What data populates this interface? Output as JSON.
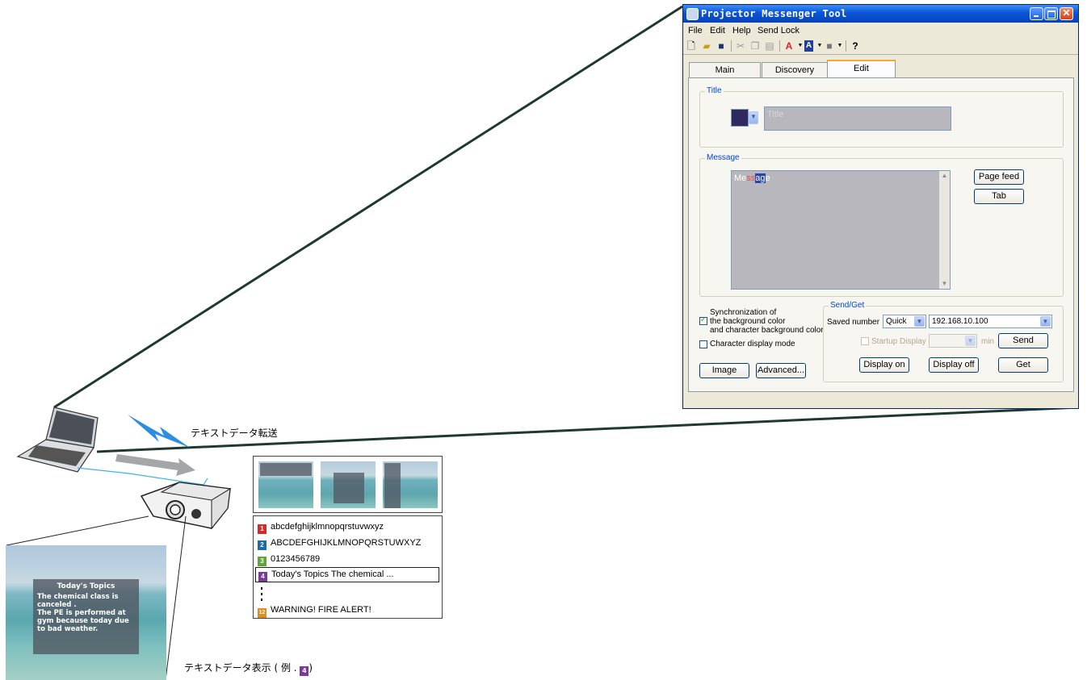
{
  "window": {
    "title": "Projector Messenger Tool",
    "close_glyph": "✕",
    "menu": [
      "File",
      "Edit",
      "Help",
      "Send Lock"
    ],
    "toolbar_icons": [
      "new-file-icon",
      "open-folder-icon",
      "save-icon",
      "cut-icon",
      "copy-icon",
      "paste-icon",
      "font-color-icon",
      "background-color-icon",
      "frame-color-icon",
      "help-icon"
    ],
    "tabs": [
      "Main",
      "Discovery",
      "Edit"
    ],
    "active_tab": "Edit"
  },
  "title_group": {
    "label": "Title",
    "placeholder": "Title",
    "swatch_color": "#2e2a60"
  },
  "message_group": {
    "label": "Message",
    "text_prefix": "Me",
    "text_red": "ss",
    "text_selected": "ag",
    "text_suffix": "e",
    "page_feed_button": "Page feed",
    "tab_button": "Tab"
  },
  "options": {
    "sync_label_line1": "Synchronization of",
    "sync_label_line2": "the background color",
    "sync_label_line3": "and character background color",
    "sync_checked": true,
    "char_mode_label": "Character display mode",
    "char_mode_checked": false,
    "image_button": "Image",
    "advanced_button": "Advanced..."
  },
  "send_get": {
    "label": "Send/Get",
    "saved_number_label": "Saved number",
    "saved_number_value": "Quick",
    "ip_address": "192.168.10.100",
    "startup_display_label": "Startup Display",
    "min_label": "min",
    "send_button": "Send",
    "display_on_button": "Display on",
    "display_off_button": "Display off",
    "get_button": "Get"
  },
  "illustration": {
    "transfer_caption": "テキストデータ転送",
    "display_caption_prefix": "テキストデータ表示 ( 例 . ",
    "display_caption_suffix": ")",
    "topic": {
      "title": "Today's Topics",
      "line1": "The chemical class is",
      "line2": "canceled .",
      "line3": "The PE is performed at",
      "line4": "gym because today due",
      "line5": "to bad weather."
    },
    "list": [
      {
        "num": "1",
        "text": "abcdefghijklmnopqrstuvwxyz",
        "color": "#d32a2a"
      },
      {
        "num": "2",
        "text": "ABCDEFGHIJKLMNOPQRSTUWXYZ",
        "color": "#1d6aa8"
      },
      {
        "num": "3",
        "text": "0123456789",
        "color": "#62a33a"
      },
      {
        "num": "4",
        "text": "Today's Topics The chemical ...",
        "color": "#7b3a9a"
      },
      {
        "num": "12",
        "text": "WARNING! FIRE ALERT!",
        "color": "#e58a20"
      }
    ],
    "caption_badge": "4"
  }
}
